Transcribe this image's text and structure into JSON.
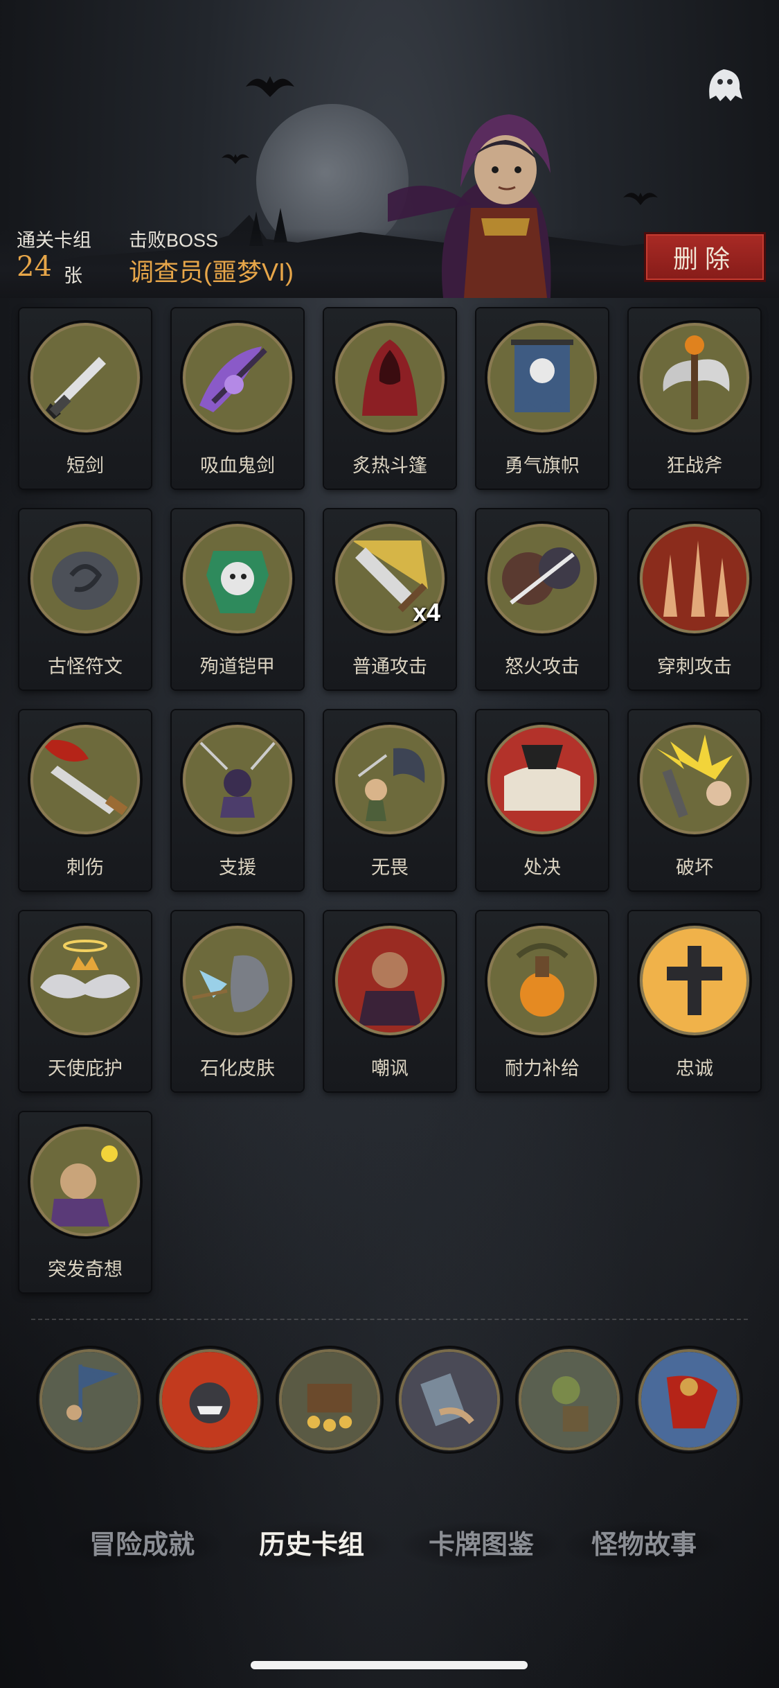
{
  "header": {
    "cleared_decks_label": "通关卡组",
    "cleared_decks_count": "24",
    "cleared_decks_unit": "张",
    "defeated_boss_label": "击败BOSS",
    "defeated_boss_name": "调查员(噩梦VI)",
    "delete_button": "删除"
  },
  "cards": [
    {
      "name": "短剑",
      "icon": "dagger-icon",
      "color": "#6d6a3c"
    },
    {
      "name": "吸血鬼剑",
      "icon": "vampire-sword-icon",
      "color": "#6d6a3c"
    },
    {
      "name": "炙热斗篷",
      "icon": "cloak-icon",
      "color": "#6d6a3c"
    },
    {
      "name": "勇气旗帜",
      "icon": "banner-icon",
      "color": "#6d6a3c"
    },
    {
      "name": "狂战斧",
      "icon": "axe-icon",
      "color": "#6d6a3c"
    },
    {
      "name": "古怪符文",
      "icon": "rune-icon",
      "color": "#6d6a3c"
    },
    {
      "name": "殉道铠甲",
      "icon": "armor-icon",
      "color": "#6d6a3c"
    },
    {
      "name": "普通攻击",
      "icon": "sword-strike-icon",
      "color": "#6d6a3c",
      "badge": "x4"
    },
    {
      "name": "怒火攻击",
      "icon": "rage-attack-icon",
      "color": "#6d6a3c"
    },
    {
      "name": "穿刺攻击",
      "icon": "pierce-attack-icon",
      "color": "#6d6a3c"
    },
    {
      "name": "刺伤",
      "icon": "stab-icon",
      "color": "#6d6a3c"
    },
    {
      "name": "支援",
      "icon": "support-icon",
      "color": "#6d6a3c"
    },
    {
      "name": "无畏",
      "icon": "fearless-icon",
      "color": "#6d6a3c"
    },
    {
      "name": "处决",
      "icon": "execute-icon",
      "color": "#6d6a3c"
    },
    {
      "name": "破坏",
      "icon": "destroy-icon",
      "color": "#6d6a3c"
    },
    {
      "name": "天使庇护",
      "icon": "angel-wings-icon",
      "color": "#6d6a3c"
    },
    {
      "name": "石化皮肤",
      "icon": "stone-skin-icon",
      "color": "#6d6a3c"
    },
    {
      "name": "嘲讽",
      "icon": "taunt-icon",
      "color": "#6d6a3c"
    },
    {
      "name": "耐力补给",
      "icon": "stamina-potion-icon",
      "color": "#6d6a3c"
    },
    {
      "name": "忠诚",
      "icon": "cross-icon",
      "color": "#6d6a3c"
    },
    {
      "name": "突发奇想",
      "icon": "idea-icon",
      "color": "#6d6a3c"
    }
  ],
  "bottom_icons": [
    {
      "icon": "flag-bearer-icon"
    },
    {
      "icon": "fire-monster-icon"
    },
    {
      "icon": "treasure-chest-icon"
    },
    {
      "icon": "card-hand-icon"
    },
    {
      "icon": "goblin-icon"
    },
    {
      "icon": "caped-hero-icon"
    }
  ],
  "tabs": {
    "adventure": "冒险成就",
    "history": "历史卡组",
    "catalog": "卡牌图鉴",
    "monster": "怪物故事"
  },
  "colors": {
    "accent": "#e7a649",
    "delete_red": "#a92a25",
    "disc_ring": "#8a7a52"
  }
}
